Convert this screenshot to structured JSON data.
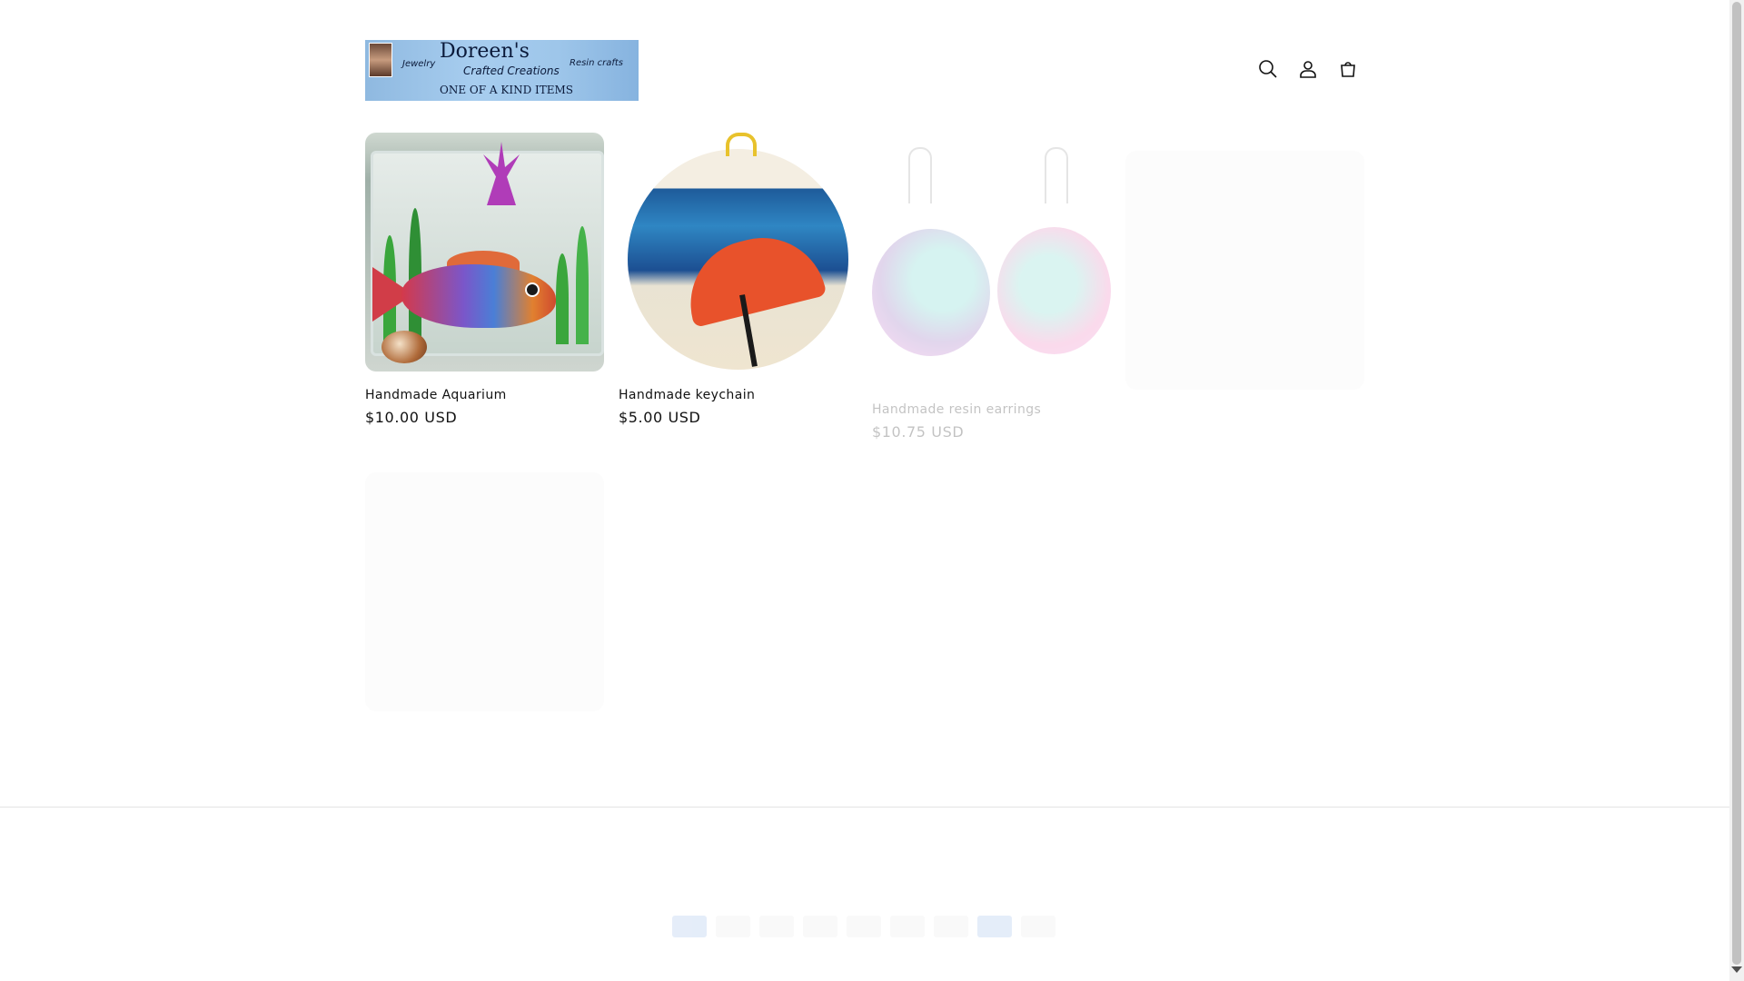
{
  "header": {
    "logo": {
      "brand": "Doreen's",
      "line_left": "Jewelry",
      "line_center": "Crafted Creations",
      "line_right": "Resin crafts",
      "tagline": "ONE OF A KIND ITEMS"
    },
    "icons": [
      "search-icon",
      "account-icon",
      "cart-icon"
    ]
  },
  "products": [
    {
      "title": "Handmade Aquarium",
      "price": "$10.00 USD"
    },
    {
      "title": "Handmade keychain",
      "price": "$5.00 USD"
    },
    {
      "title": "Handmade resin earrings",
      "price": "$10.75 USD"
    }
  ],
  "footer": {
    "payment_icons": [
      "american-express-icon",
      "apple-pay-icon",
      "diners-club-icon",
      "discover-icon",
      "google-pay-icon",
      "mastercard-icon",
      "paypal-icon",
      "shop-pay-icon",
      "visa-icon"
    ]
  }
}
